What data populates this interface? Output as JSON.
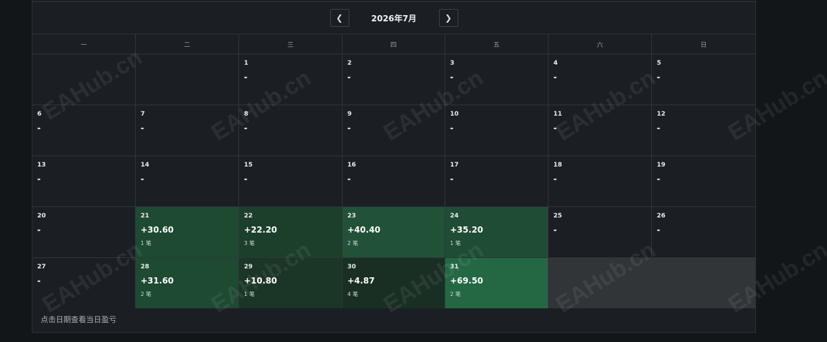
{
  "header": {
    "prev_label": "❮",
    "next_label": "❯",
    "title": "2026年7月"
  },
  "weekdays": [
    "一",
    "二",
    "三",
    "四",
    "五",
    "六",
    "日"
  ],
  "rows": [
    [
      {
        "day": "",
        "pnl": "",
        "trades": "",
        "empty": true
      },
      {
        "day": "",
        "pnl": "",
        "trades": "",
        "empty": true
      },
      {
        "day": "1",
        "pnl": "-",
        "trades": ""
      },
      {
        "day": "2",
        "pnl": "-",
        "trades": ""
      },
      {
        "day": "3",
        "pnl": "-",
        "trades": ""
      },
      {
        "day": "4",
        "pnl": "-",
        "trades": ""
      },
      {
        "day": "5",
        "pnl": "-",
        "trades": ""
      }
    ],
    [
      {
        "day": "6",
        "pnl": "-",
        "trades": ""
      },
      {
        "day": "7",
        "pnl": "-",
        "trades": ""
      },
      {
        "day": "8",
        "pnl": "-",
        "trades": ""
      },
      {
        "day": "9",
        "pnl": "-",
        "trades": ""
      },
      {
        "day": "10",
        "pnl": "-",
        "trades": ""
      },
      {
        "day": "11",
        "pnl": "-",
        "trades": ""
      },
      {
        "day": "12",
        "pnl": "-",
        "trades": ""
      }
    ],
    [
      {
        "day": "13",
        "pnl": "-",
        "trades": ""
      },
      {
        "day": "14",
        "pnl": "-",
        "trades": ""
      },
      {
        "day": "15",
        "pnl": "-",
        "trades": ""
      },
      {
        "day": "16",
        "pnl": "-",
        "trades": ""
      },
      {
        "day": "17",
        "pnl": "-",
        "trades": ""
      },
      {
        "day": "18",
        "pnl": "-",
        "trades": ""
      },
      {
        "day": "19",
        "pnl": "-",
        "trades": ""
      }
    ],
    [
      {
        "day": "20",
        "pnl": "-",
        "trades": ""
      },
      {
        "day": "21",
        "pnl": "+30.60",
        "trades": "1 笔",
        "color": "#1e4a32"
      },
      {
        "day": "22",
        "pnl": "+22.20",
        "trades": "3 笔",
        "color": "#1c3f2c"
      },
      {
        "day": "23",
        "pnl": "+40.40",
        "trades": "2 笔",
        "color": "#215238"
      },
      {
        "day": "24",
        "pnl": "+35.20",
        "trades": "1 笔",
        "color": "#1f4c34"
      },
      {
        "day": "25",
        "pnl": "-",
        "trades": ""
      },
      {
        "day": "26",
        "pnl": "-",
        "trades": ""
      }
    ],
    [
      {
        "day": "27",
        "pnl": "-",
        "trades": ""
      },
      {
        "day": "28",
        "pnl": "+31.60",
        "trades": "2 笔",
        "color": "#1e4a32"
      },
      {
        "day": "29",
        "pnl": "+10.80",
        "trades": "1 笔",
        "color": "#1b3526"
      },
      {
        "day": "30",
        "pnl": "+4.87",
        "trades": "4 笔",
        "color": "#1a2f24"
      },
      {
        "day": "31",
        "pnl": "+69.50",
        "trades": "2 笔",
        "color": "#236843"
      },
      {
        "day": "",
        "pnl": "",
        "trades": "",
        "filler": true
      },
      {
        "day": "",
        "pnl": "",
        "trades": "",
        "filler": true
      }
    ]
  ],
  "footer": {
    "hint": "点击日期查看当日盈亏"
  },
  "watermark": {
    "text": "EAHub.cn"
  }
}
